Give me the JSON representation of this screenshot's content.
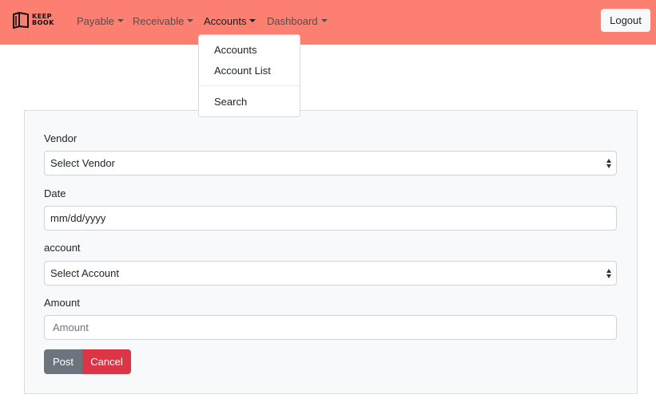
{
  "brand": {
    "logo_icon": "open-book-icon",
    "line1": "KEEP",
    "line2": "BOOK"
  },
  "nav": {
    "items": [
      {
        "label": "Payable"
      },
      {
        "label": "Receivable"
      },
      {
        "label": "Accounts"
      },
      {
        "label": "Dashboard"
      }
    ],
    "logout_label": "Logout"
  },
  "dropdown": {
    "items": [
      {
        "label": "Accounts"
      },
      {
        "label": "Account List"
      },
      {
        "label": "Search"
      }
    ]
  },
  "form": {
    "vendor": {
      "label": "Vendor",
      "value": "Select Vendor"
    },
    "date": {
      "label": "Date",
      "value": "mm/dd/yyyy"
    },
    "account": {
      "label": "account",
      "value": "Select Account"
    },
    "amount": {
      "label": "Amount",
      "placeholder": "Amount"
    },
    "post_label": "Post",
    "cancel_label": "Cancel"
  },
  "colors": {
    "navbar": "#fc7f72",
    "post": "#6c757d",
    "cancel": "#dc3545"
  }
}
